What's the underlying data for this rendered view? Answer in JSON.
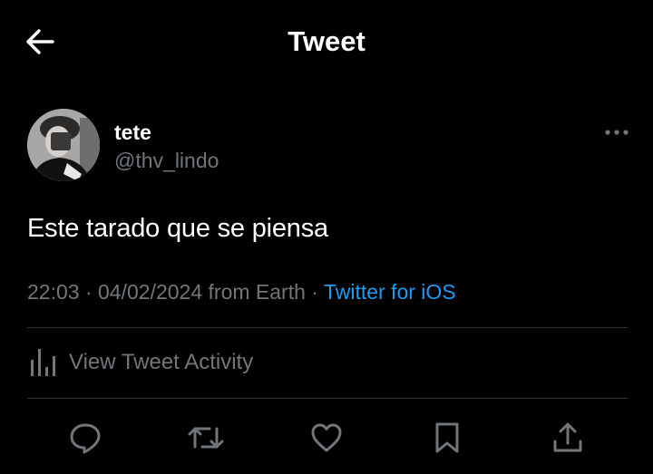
{
  "header": {
    "title": "Tweet",
    "back_icon": "arrow-left-icon"
  },
  "author": {
    "display_name": "tete",
    "handle": "@thv_lindo",
    "avatar": "user-avatar"
  },
  "tweet": {
    "text": "Este tarado que se piensa",
    "time": "22:03",
    "date": "04/02/2024",
    "location": "from Earth",
    "source": "Twitter for iOS"
  },
  "activity": {
    "label": "View Tweet Activity",
    "icon": "bar-chart-icon"
  },
  "actions": {
    "reply": "reply-icon",
    "retweet": "retweet-icon",
    "like": "heart-icon",
    "bookmark": "bookmark-icon",
    "share": "share-icon"
  },
  "colors": {
    "background": "#000000",
    "primary_text": "#ffffff",
    "secondary_text": "#71767b",
    "link": "#1d9bf0",
    "divider": "#2f3336"
  }
}
